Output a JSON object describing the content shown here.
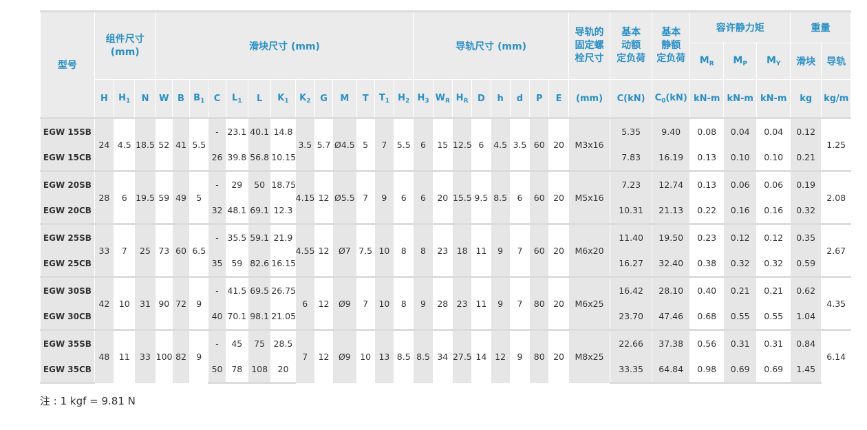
{
  "header": {
    "model": "型号",
    "assembly_size": "组件尺寸",
    "assembly_unit": "(mm)",
    "block_size": "滑块尺寸 (mm)",
    "rail_size": "导轨尺寸 (mm)",
    "bolt_l1": "导轨的",
    "bolt_l2": "固定螺",
    "bolt_l3": "栓尺寸",
    "dyn_l1": "基本",
    "dyn_l2": "动额",
    "dyn_l3": "定负荷",
    "stat_l1": "基本",
    "stat_l2": "静额",
    "stat_l3": "定负荷",
    "moment": "容许静力矩",
    "weight": "重量",
    "block": "滑块",
    "rail": "导轨",
    "bolt_unit": "(mm)",
    "dyn_unit": "C(kN)",
    "stat_unit": "(kN)",
    "moment_unit": "kN-m",
    "block_unit": "kg",
    "rail_unit": "kg/m"
  },
  "columns": [
    "H",
    "H",
    "N",
    "W",
    "B",
    "B",
    "C",
    "L",
    "L",
    "K",
    "K",
    "G",
    "M",
    "T",
    "T",
    "H",
    "H",
    "W",
    "H",
    "D",
    "h",
    "d",
    "P",
    "E"
  ],
  "column_subs": [
    "",
    "1",
    "",
    "",
    "",
    "1",
    "",
    "1",
    "",
    "1",
    "2",
    "",
    "",
    "",
    "1",
    "2",
    "3",
    "R",
    "R",
    "",
    "",
    "",
    "",
    ""
  ],
  "moments": [
    {
      "letter": "M",
      "sub": "R"
    },
    {
      "letter": "M",
      "sub": "P"
    },
    {
      "letter": "M",
      "sub": "Y"
    }
  ],
  "c0": {
    "letter": "C",
    "sub": "0"
  },
  "rows": [
    {
      "model": "EGW 15SB",
      "H": "24",
      "H1": "4.5",
      "N": "18.5",
      "W": "52",
      "B": "41",
      "B1": "5.5",
      "C": "-",
      "L1": "23.1",
      "L": "40.1",
      "K1": "14.8",
      "K2": "3.5",
      "G": "5.7",
      "M": "Ø4.5",
      "T": "5",
      "T1": "7",
      "H2": "5.5",
      "H3": "6",
      "WR": "15",
      "HR": "12.5",
      "D": "6",
      "h": "4.5",
      "d": "3.5",
      "P": "60",
      "E": "20",
      "bolt": "M3x16",
      "Cdyn": "5.35",
      "C0": "9.40",
      "MR": "0.08",
      "MP": "0.04",
      "MY": "0.04",
      "block_kg": "0.12",
      "rail_kgm": "1.25"
    },
    {
      "model": "EGW 15CB",
      "C": "26",
      "L1": "39.8",
      "L": "56.8",
      "K1": "10.15",
      "Cdyn": "7.83",
      "C0": "16.19",
      "MR": "0.13",
      "MP": "0.10",
      "MY": "0.10",
      "block_kg": "0.21"
    },
    {
      "model": "EGW 20SB",
      "H": "28",
      "H1": "6",
      "N": "19.5",
      "W": "59",
      "B": "49",
      "B1": "5",
      "C": "-",
      "L1": "29",
      "L": "50",
      "K1": "18.75",
      "K2": "4.15",
      "G": "12",
      "M": "Ø5.5",
      "T": "7",
      "T1": "9",
      "H2": "6",
      "H3": "6",
      "WR": "20",
      "HR": "15.5",
      "D": "9.5",
      "h": "8.5",
      "d": "6",
      "P": "60",
      "E": "20",
      "bolt": "M5x16",
      "Cdyn": "7.23",
      "C0": "12.74",
      "MR": "0.13",
      "MP": "0.06",
      "MY": "0.06",
      "block_kg": "0.19",
      "rail_kgm": "2.08"
    },
    {
      "model": "EGW 20CB",
      "C": "32",
      "L1": "48.1",
      "L": "69.1",
      "K1": "12.3",
      "Cdyn": "10.31",
      "C0": "21.13",
      "MR": "0.22",
      "MP": "0.16",
      "MY": "0.16",
      "block_kg": "0.32"
    },
    {
      "model": "EGW 25SB",
      "H": "33",
      "H1": "7",
      "N": "25",
      "W": "73",
      "B": "60",
      "B1": "6.5",
      "C": "-",
      "L1": "35.5",
      "L": "59.1",
      "K1": "21.9",
      "K2": "4.55",
      "G": "12",
      "M": "Ø7",
      "T": "7.5",
      "T1": "10",
      "H2": "8",
      "H3": "8",
      "WR": "23",
      "HR": "18",
      "D": "11",
      "h": "9",
      "d": "7",
      "P": "60",
      "E": "20",
      "bolt": "M6x20",
      "Cdyn": "11.40",
      "C0": "19.50",
      "MR": "0.23",
      "MP": "0.12",
      "MY": "0.12",
      "block_kg": "0.35",
      "rail_kgm": "2.67"
    },
    {
      "model": "EGW 25CB",
      "C": "35",
      "L1": "59",
      "L": "82.6",
      "K1": "16.15",
      "Cdyn": "16.27",
      "C0": "32.40",
      "MR": "0.38",
      "MP": "0.32",
      "MY": "0.32",
      "block_kg": "0.59"
    },
    {
      "model": "EGW 30SB",
      "H": "42",
      "H1": "10",
      "N": "31",
      "W": "90",
      "B": "72",
      "B1": "9",
      "C": "-",
      "L1": "41.5",
      "L": "69.5",
      "K1": "26.75",
      "K2": "6",
      "G": "12",
      "M": "Ø9",
      "T": "7",
      "T1": "10",
      "H2": "8",
      "H3": "9",
      "WR": "28",
      "HR": "23",
      "D": "11",
      "h": "9",
      "d": "7",
      "P": "80",
      "E": "20",
      "bolt": "M6x25",
      "Cdyn": "16.42",
      "C0": "28.10",
      "MR": "0.40",
      "MP": "0.21",
      "MY": "0.21",
      "block_kg": "0.62",
      "rail_kgm": "4.35"
    },
    {
      "model": "EGW 30CB",
      "C": "40",
      "L1": "70.1",
      "L": "98.1",
      "K1": "21.05",
      "Cdyn": "23.70",
      "C0": "47.46",
      "MR": "0.68",
      "MP": "0.55",
      "MY": "0.55",
      "block_kg": "1.04"
    },
    {
      "model": "EGW 35SB",
      "H": "48",
      "H1": "11",
      "N": "33",
      "W": "100",
      "B": "82",
      "B1": "9",
      "C": "-",
      "L1": "45",
      "L": "75",
      "K1": "28.5",
      "K2": "7",
      "G": "12",
      "M": "Ø9",
      "T": "10",
      "T1": "13",
      "H2": "8.5",
      "H3": "8.5",
      "WR": "34",
      "HR": "27.5",
      "D": "14",
      "h": "12",
      "d": "9",
      "P": "80",
      "E": "20",
      "bolt": "M8x25",
      "Cdyn": "22.66",
      "C0": "37.38",
      "MR": "0.56",
      "MP": "0.31",
      "MY": "0.31",
      "block_kg": "0.84",
      "rail_kgm": "6.14"
    },
    {
      "model": "EGW 35CB",
      "C": "50",
      "L1": "78",
      "L": "108",
      "K1": "20",
      "Cdyn": "33.35",
      "C0": "64.84",
      "MR": "0.98",
      "MP": "0.69",
      "MY": "0.69",
      "block_kg": "1.45"
    }
  ],
  "note": "注 : 1 kgf = 9.81 N"
}
